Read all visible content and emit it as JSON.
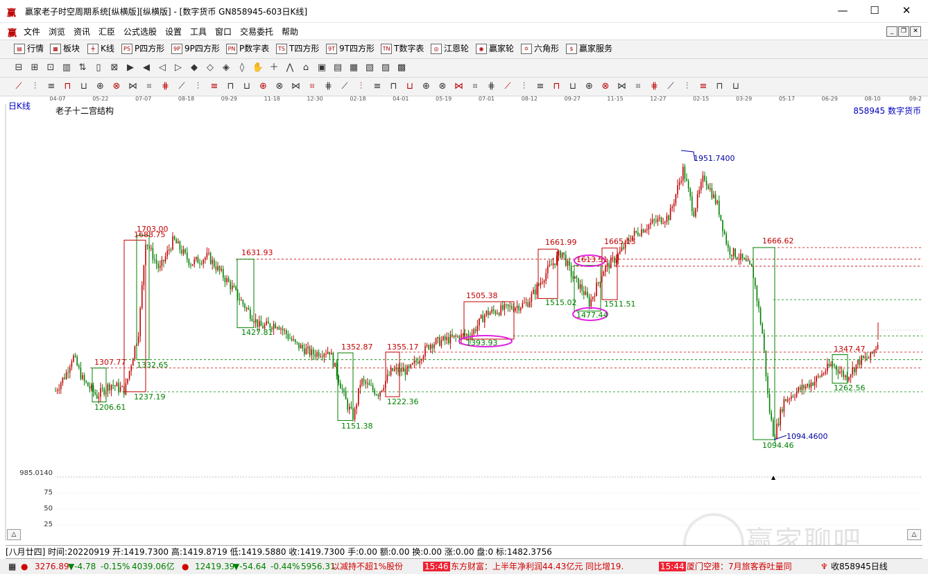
{
  "window": {
    "app_icon": "赢",
    "title": "赢家老子时空周期系统[纵横版][纵横版] - [数字货币   GN858945-603日K线]",
    "minimize": "—",
    "maximize": "☐",
    "close": "✕"
  },
  "menu": {
    "icon": "赢",
    "items": [
      "文件",
      "浏览",
      "资讯",
      "汇臣",
      "公式选股",
      "设置",
      "工具",
      "窗口",
      "交易委托",
      "帮助"
    ],
    "mdi_min": "_",
    "mdi_restore": "❐",
    "mdi_close": "✕"
  },
  "toolbar1": {
    "items": [
      {
        "icon": "▤",
        "label": "行情"
      },
      {
        "icon": "▦",
        "label": "板块"
      },
      {
        "icon": "╪",
        "label": "K线"
      },
      {
        "icon": "PS",
        "label": "P四方形"
      },
      {
        "icon": "9P",
        "label": "9P四方形"
      },
      {
        "icon": "PN",
        "label": "P数字表"
      },
      {
        "icon": "TS",
        "label": "T四方形"
      },
      {
        "icon": "9T",
        "label": "9T四方形"
      },
      {
        "icon": "TN",
        "label": "T数字表"
      },
      {
        "icon": "◎",
        "label": "江恩轮"
      },
      {
        "icon": "◉",
        "label": "赢家轮"
      },
      {
        "icon": "✡",
        "label": "六角形"
      },
      {
        "icon": "$",
        "label": "赢家服务"
      }
    ]
  },
  "chart": {
    "period_label": "日K线",
    "structure_label": "老子十二宫结构",
    "code_label": "858945  数字货币",
    "date_ticks": [
      "04-07",
      "05-22",
      "07-07",
      "08-18",
      "09-29",
      "11-18",
      "12-30",
      "02-18",
      "04-01",
      "05-19",
      "07-01",
      "08-12",
      "09-27",
      "11-15",
      "12-27",
      "02-15",
      "03-29",
      "05-17",
      "06-29",
      "08-10",
      "09-2"
    ],
    "price_labels": [
      {
        "text": "1703.00",
        "color": "#c00000"
      },
      {
        "text": "1688.75",
        "color": "#c00000"
      },
      {
        "text": "1631.93",
        "color": "#c00000"
      },
      {
        "text": "1427.81",
        "color": "#008000"
      },
      {
        "text": "1307.77",
        "color": "#c00000"
      },
      {
        "text": "1332.65",
        "color": "#008000"
      },
      {
        "text": "1237.19",
        "color": "#008000"
      },
      {
        "text": "1206.61",
        "color": "#008000"
      },
      {
        "text": "1352.87",
        "color": "#c00000"
      },
      {
        "text": "1151.38",
        "color": "#008000"
      },
      {
        "text": "1355.17",
        "color": "#c00000"
      },
      {
        "text": "1222.36",
        "color": "#008000"
      },
      {
        "text": "1505.38",
        "color": "#c00000"
      },
      {
        "text": "1393.93",
        "color": "#008000"
      },
      {
        "text": "1661.99",
        "color": "#c00000"
      },
      {
        "text": "1515.02",
        "color": "#008000"
      },
      {
        "text": "1613.51",
        "color": "#c00000"
      },
      {
        "text": "1477.44",
        "color": "#008000"
      },
      {
        "text": "1665.13",
        "color": "#c00000"
      },
      {
        "text": "1511.51",
        "color": "#008000"
      },
      {
        "text": "1951.7400",
        "color": "#0000a0"
      },
      {
        "text": "1666.62",
        "color": "#c00000"
      },
      {
        "text": "1094.46",
        "color": "#008000"
      },
      {
        "text": "1094.4600",
        "color": "#0000a0"
      },
      {
        "text": "1347.47",
        "color": "#c00000"
      },
      {
        "text": "1262.56",
        "color": "#008000"
      }
    ],
    "indicator_top": "985.0140",
    "indicator_levels": [
      "75",
      "50",
      "25"
    ]
  },
  "status": {
    "text": "[八月廿四] 时间:20220919 开:1419.7300 高:1419.8719 低:1419.5880 收:1419.7300 手:0.00 额:0.00 换:0.00 涨:0.00 盘:0 标:1482.3756"
  },
  "ticker": {
    "index1_value": "3276.89",
    "index1_change": "▼-4.78",
    "index1_pct": "-0.15%",
    "index1_amount": "4039.06亿",
    "index2_value": "12419.39",
    "index2_change": "▼-54.64",
    "index2_pct": "-0.44%",
    "index2_amount": "5956.31",
    "news1": "以减持不超1%股份",
    "time1": "15:46",
    "news2": "东方财富：上半年净利润44.43亿元 同比增19.",
    "time2": "15:44",
    "news3": "厦门空港：7月旅客吞吐量同",
    "right_label": "收858945日线"
  },
  "watermark": {
    "text": "赢家聊吧"
  },
  "colors": {
    "up": "#c00000",
    "down": "#008000",
    "ellipse": "#e020e0",
    "peak": "#0000a0"
  }
}
